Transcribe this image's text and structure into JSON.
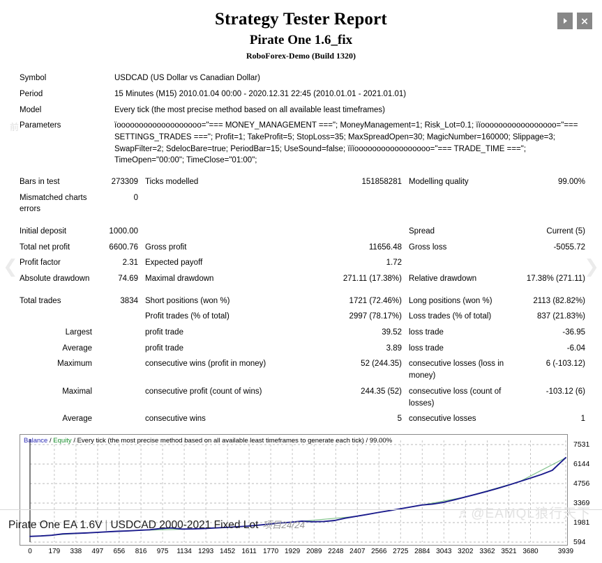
{
  "window_controls": [
    {
      "name": "next-button",
      "glyph": "▶"
    },
    {
      "name": "close-button",
      "glyph": "✕"
    }
  ],
  "header": {
    "title": "Strategy Tester Report",
    "expert": "Pirate One 1.6_fix",
    "broker": "RoboForex-Demo (Build 1320)"
  },
  "info": {
    "symbol_label": "Symbol",
    "symbol_value": "USDCAD (US Dollar vs Canadian Dollar)",
    "period_label": "Period",
    "period_value": "15 Minutes (M15) 2010.01.04 00:00 - 2020.12.31 22:45 (2010.01.01 - 2021.01.01)",
    "model_label": "Model",
    "model_value": "Every tick (the most precise method based on all available least timeframes)",
    "parameters_label": "Parameters",
    "parameters_value": "ïooooooooooooooooooo=\"=== MONEY_MANAGEMENT ===\"; MoneyManagement=1; Risk_Lot=0.1; ïïooooooooooooooooo=\"=== SETTINGS_TRADES ===\"; Profit=1; TakeProfit=5; StopLoss=35; MaxSpreadOpen=30; MagicNumber=160000; Slippage=3; SwapFilter=2; SdelocBare=true; PeriodBar=15; UseSound=false; ïïïooooooooooooooooo=\"=== TRADE_TIME ===\"; TimeOpen=\"00:00\"; TimeClose=\"01:00\";"
  },
  "stats": {
    "bars_in_test_label": "Bars in test",
    "bars_in_test_value": "273309",
    "ticks_modelled_label": "Ticks modelled",
    "ticks_modelled_value": "151858281",
    "modelling_quality_label": "Modelling quality",
    "modelling_quality_value": "99.00%",
    "mismatched_label": "Mismatched charts errors",
    "mismatched_value": "0",
    "initial_deposit_label": "Initial deposit",
    "initial_deposit_value": "1000.00",
    "spread_label": "Spread",
    "spread_value": "Current (5)",
    "total_net_profit_label": "Total net profit",
    "total_net_profit_value": "6600.76",
    "gross_profit_label": "Gross profit",
    "gross_profit_value": "11656.48",
    "gross_loss_label": "Gross loss",
    "gross_loss_value": "-5055.72",
    "profit_factor_label": "Profit factor",
    "profit_factor_value": "2.31",
    "expected_payoff_label": "Expected payoff",
    "expected_payoff_value": "1.72",
    "absolute_drawdown_label": "Absolute drawdown",
    "absolute_drawdown_value": "74.69",
    "maximal_drawdown_label": "Maximal drawdown",
    "maximal_drawdown_value": "271.11 (17.38%)",
    "relative_drawdown_label": "Relative drawdown",
    "relative_drawdown_value": "17.38% (271.11)",
    "total_trades_label": "Total trades",
    "total_trades_value": "3834",
    "short_positions_label": "Short positions (won %)",
    "short_positions_value": "1721 (72.46%)",
    "long_positions_label": "Long positions (won %)",
    "long_positions_value": "2113 (82.82%)",
    "profit_trades_label": "Profit trades (% of total)",
    "profit_trades_value": "2997 (78.17%)",
    "loss_trades_label": "Loss trades (% of total)",
    "loss_trades_value": "837 (21.83%)",
    "largest_label": "Largest",
    "largest_profit_label": "profit trade",
    "largest_profit_value": "39.52",
    "largest_loss_label": "loss trade",
    "largest_loss_value": "-36.95",
    "average_label": "Average",
    "average_profit_label": "profit trade",
    "average_profit_value": "3.89",
    "average_loss_label": "loss trade",
    "average_loss_value": "-6.04",
    "maximum_label": "Maximum",
    "max_cons_wins_label": "consecutive wins (profit in money)",
    "max_cons_wins_value": "52 (244.35)",
    "max_cons_losses_label": "consecutive losses (loss in money)",
    "max_cons_losses_value": "6 (-103.12)",
    "maximal_label": "Maximal",
    "maximal_cons_profit_label": "consecutive profit (count of wins)",
    "maximal_cons_profit_value": "244.35 (52)",
    "maximal_cons_loss_label": "consecutive loss (count of losses)",
    "maximal_cons_loss_value": "-103.12 (6)",
    "average2_label": "Average",
    "avg_cons_wins_label": "consecutive wins",
    "avg_cons_wins_value": "5",
    "avg_cons_losses_label": "consecutive losses",
    "avg_cons_losses_value": "1"
  },
  "chart_data": {
    "type": "line",
    "title": "",
    "legend": {
      "balance": "Balance",
      "equity": "Equity",
      "separator": "/",
      "description": "Every tick (the most precise method based on all available least timeframes to generate each tick)",
      "quality": "99.00%"
    },
    "xlabel": "",
    "ylabel": "",
    "xlim": [
      0,
      3939
    ],
    "ylim": [
      594,
      7531
    ],
    "grid": true,
    "x_ticks": [
      0,
      179,
      338,
      497,
      656,
      816,
      975,
      1134,
      1293,
      1452,
      1611,
      1770,
      1929,
      2089,
      2248,
      2407,
      2566,
      2725,
      2884,
      3043,
      3202,
      3362,
      3521,
      3680,
      3939
    ],
    "y_ticks": [
      594,
      1981,
      3369,
      4756,
      6144,
      7531
    ],
    "series": [
      {
        "name": "Balance",
        "color": "#1a1a8c",
        "x": [
          0,
          80,
          160,
          240,
          320,
          400,
          480,
          560,
          640,
          720,
          800,
          880,
          960,
          1040,
          1120,
          1200,
          1280,
          1360,
          1440,
          1520,
          1600,
          1680,
          1760,
          1840,
          1920,
          2000,
          2080,
          2160,
          2240,
          2320,
          2400,
          2480,
          2560,
          2640,
          2720,
          2800,
          2880,
          2960,
          3040,
          3120,
          3200,
          3280,
          3360,
          3440,
          3520,
          3600,
          3680,
          3760,
          3840,
          3939
        ],
        "y": [
          1000,
          1030,
          1080,
          1180,
          1210,
          1240,
          1280,
          1320,
          1360,
          1390,
          1430,
          1470,
          1560,
          1600,
          1520,
          1530,
          1560,
          1600,
          1640,
          1680,
          1730,
          1800,
          1870,
          1950,
          2010,
          2080,
          2040,
          2060,
          2130,
          2300,
          2430,
          2560,
          2700,
          2830,
          2960,
          3090,
          3230,
          3300,
          3420,
          3600,
          3800,
          4000,
          4200,
          4420,
          4650,
          4900,
          5150,
          5400,
          5700,
          6600
        ]
      },
      {
        "name": "Equity",
        "color": "#1a8f2e",
        "x": [
          0,
          400,
          800,
          1200,
          1600,
          2000,
          2400,
          2800,
          3200,
          3600,
          3939
        ],
        "y": [
          1000,
          1235,
          1425,
          1525,
          1725,
          2075,
          2425,
          3085,
          3795,
          4895,
          6595
        ]
      }
    ]
  },
  "footer": {
    "title": "Pirate One EA 1.6V",
    "separator": "|",
    "subtitle": "USDCAD 2000-2021 Fixed Lot",
    "count": "项目24/24"
  },
  "watermarks": {
    "right": "♬@EAMQL狼行天下",
    "params": "前",
    "left_arrow": "❮",
    "right_arrow": "❯"
  }
}
